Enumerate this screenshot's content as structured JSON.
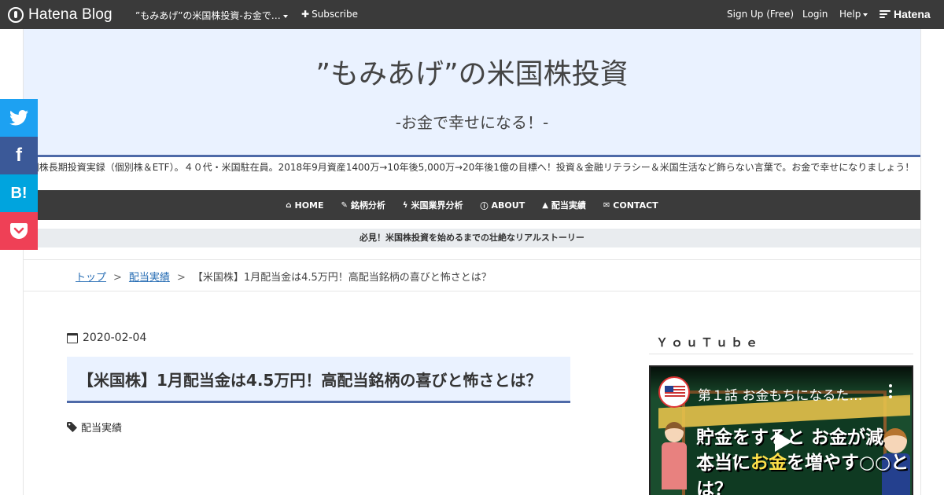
{
  "topbar": {
    "logo_text": "Hatena Blog",
    "blog_name": "”もみあげ”の米国株投資-お金で…",
    "subscribe": "Subscribe",
    "signup": "Sign Up (Free)",
    "login": "Login",
    "help": "Help",
    "hatena": "Hatena"
  },
  "header": {
    "title": "”もみあげ”の米国株投資",
    "subtitle": "-お金で幸せになる！-"
  },
  "description": "国株長期投資実録（個別株＆ETF）。４０代・米国駐在員。2018年9月資産1400万→10年後5,000万→20年後1億の目標へ！投資＆金融リテラシー＆米国生活など飾らない言葉で。お金で幸せになりましょう！",
  "nav": {
    "items": [
      {
        "label": "HOME",
        "icon": "home-icon",
        "glyph": "⌂"
      },
      {
        "label": "銘柄分析",
        "icon": "wrench-icon",
        "glyph": "✎"
      },
      {
        "label": "米国業界分析",
        "icon": "bolt-icon",
        "glyph": "ϟ"
      },
      {
        "label": "ABOUT",
        "icon": "info-icon",
        "glyph": "ⓘ"
      },
      {
        "label": "配当実績",
        "icon": "graduation-cap-icon",
        "glyph": "▲"
      },
      {
        "label": "CONTACT",
        "icon": "envelope-icon",
        "glyph": "✉"
      }
    ]
  },
  "banner": "必見！米国株投資を始めるまでの壮絶なリアルストーリー",
  "breadcrumb": {
    "top": "トップ",
    "category": "配当実績",
    "current": "【米国株】1月配当金は4.5万円！高配当銘柄の喜びと怖さとは？",
    "separator": ">"
  },
  "share": {
    "facebook": "f",
    "hatebu": "B!"
  },
  "article": {
    "date": "2020-02-04",
    "title": "【米国株】1月配当金は4.5万円！高配当銘柄の喜びと怖さとは？",
    "category": "配当実績"
  },
  "sidebar": {
    "youtube_title": "ＹｏｕＴｕｂｅ",
    "video": {
      "title": "第１話 お金もちになるた…",
      "line1": "貯金をすると お金が減る！？",
      "line2_a": "本当に",
      "line2_hl": "お金",
      "line2_b": "を増やす○○とは？"
    }
  },
  "colors": {
    "topbar": "#3a3a3a",
    "header_bg": "#eaf2ff",
    "accent": "#4e6aa8",
    "nav_bg": "#3b3b3b",
    "twitter": "#1da1f2",
    "facebook": "#3b5998",
    "hatebu": "#00a4de",
    "pocket": "#ef4056"
  }
}
